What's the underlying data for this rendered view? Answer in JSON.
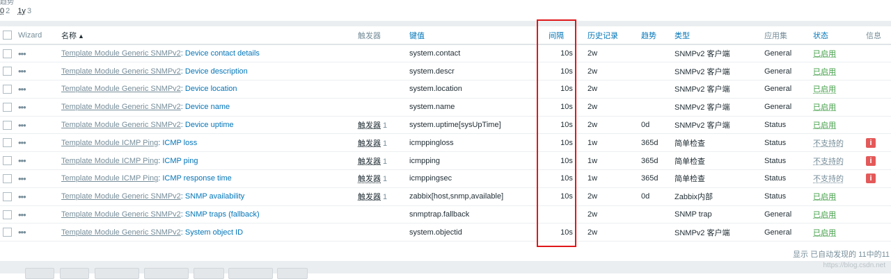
{
  "filter": {
    "section_label": "趋势",
    "options": [
      {
        "label": "0",
        "count": "2"
      },
      {
        "label": "1y",
        "count": "3"
      }
    ]
  },
  "columns": {
    "wizard": "Wizard",
    "name": "名称",
    "triggers": "触发器",
    "key": "键值",
    "interval": "间隔",
    "history": "历史记录",
    "trends": "趋势",
    "type": "类型",
    "application": "应用集",
    "status": "状态",
    "info": "信息"
  },
  "icons": {
    "sort": "sort-asc-icon",
    "wizard": "ellipsis-icon",
    "info": "error-info-icon"
  },
  "colors": {
    "link": "#0275b8",
    "muted": "#768d99",
    "enabled": "#429e47",
    "error": "#e45959",
    "highlight": "#e0161a"
  },
  "rows": [
    {
      "host": "Template Module Generic SNMPv2",
      "name": "Device contact details",
      "triggers": "",
      "trigger_count": "",
      "key": "system.contact",
      "interval": "10s",
      "history": "2w",
      "trends": "",
      "type": "SNMPv2 客户端",
      "application": "General",
      "status": "已启用",
      "status_kind": "enabled",
      "info": ""
    },
    {
      "host": "Template Module Generic SNMPv2",
      "name": "Device description",
      "triggers": "",
      "trigger_count": "",
      "key": "system.descr",
      "interval": "10s",
      "history": "2w",
      "trends": "",
      "type": "SNMPv2 客户端",
      "application": "General",
      "status": "已启用",
      "status_kind": "enabled",
      "info": ""
    },
    {
      "host": "Template Module Generic SNMPv2",
      "name": "Device location",
      "triggers": "",
      "trigger_count": "",
      "key": "system.location",
      "interval": "10s",
      "history": "2w",
      "trends": "",
      "type": "SNMPv2 客户端",
      "application": "General",
      "status": "已启用",
      "status_kind": "enabled",
      "info": ""
    },
    {
      "host": "Template Module Generic SNMPv2",
      "name": "Device name",
      "triggers": "",
      "trigger_count": "",
      "key": "system.name",
      "interval": "10s",
      "history": "2w",
      "trends": "",
      "type": "SNMPv2 客户端",
      "application": "General",
      "status": "已启用",
      "status_kind": "enabled",
      "info": ""
    },
    {
      "host": "Template Module Generic SNMPv2",
      "name": "Device uptime",
      "triggers": "触发器",
      "trigger_count": "1",
      "key": "system.uptime[sysUpTime]",
      "interval": "10s",
      "history": "2w",
      "trends": "0d",
      "type": "SNMPv2 客户端",
      "application": "Status",
      "status": "已启用",
      "status_kind": "enabled",
      "info": ""
    },
    {
      "host": "Template Module ICMP Ping",
      "name": "ICMP loss",
      "triggers": "触发器",
      "trigger_count": "1",
      "key": "icmppingloss",
      "interval": "10s",
      "history": "1w",
      "trends": "365d",
      "type": "简单检查",
      "application": "Status",
      "status": "不支持的",
      "status_kind": "unsupported",
      "info": "i"
    },
    {
      "host": "Template Module ICMP Ping",
      "name": "ICMP ping",
      "triggers": "触发器",
      "trigger_count": "1",
      "key": "icmpping",
      "interval": "10s",
      "history": "1w",
      "trends": "365d",
      "type": "简单检查",
      "application": "Status",
      "status": "不支持的",
      "status_kind": "unsupported",
      "info": "i"
    },
    {
      "host": "Template Module ICMP Ping",
      "name": "ICMP response time",
      "triggers": "触发器",
      "trigger_count": "1",
      "key": "icmppingsec",
      "interval": "10s",
      "history": "1w",
      "trends": "365d",
      "type": "简单检查",
      "application": "Status",
      "status": "不支持的",
      "status_kind": "unsupported",
      "info": "i"
    },
    {
      "host": "Template Module Generic SNMPv2",
      "name": "SNMP availability",
      "triggers": "触发器",
      "trigger_count": "1",
      "key": "zabbix[host,snmp,available]",
      "interval": "10s",
      "history": "2w",
      "trends": "0d",
      "type": "Zabbix内部",
      "application": "Status",
      "status": "已启用",
      "status_kind": "enabled",
      "info": ""
    },
    {
      "host": "Template Module Generic SNMPv2",
      "name": "SNMP traps (fallback)",
      "triggers": "",
      "trigger_count": "",
      "key": "snmptrap.fallback",
      "interval": "",
      "history": "2w",
      "trends": "",
      "type": "SNMP trap",
      "application": "General",
      "status": "已启用",
      "status_kind": "enabled",
      "info": ""
    },
    {
      "host": "Template Module Generic SNMPv2",
      "name": "System object ID",
      "triggers": "",
      "trigger_count": "",
      "key": "system.objectid",
      "interval": "10s",
      "history": "2w",
      "trends": "",
      "type": "SNMPv2 客户端",
      "application": "General",
      "status": "已启用",
      "status_kind": "enabled",
      "info": ""
    }
  ],
  "footer": {
    "count_text": "显示 已自动发现的 11中的11"
  },
  "watermark": "https://blog.csdn.net"
}
